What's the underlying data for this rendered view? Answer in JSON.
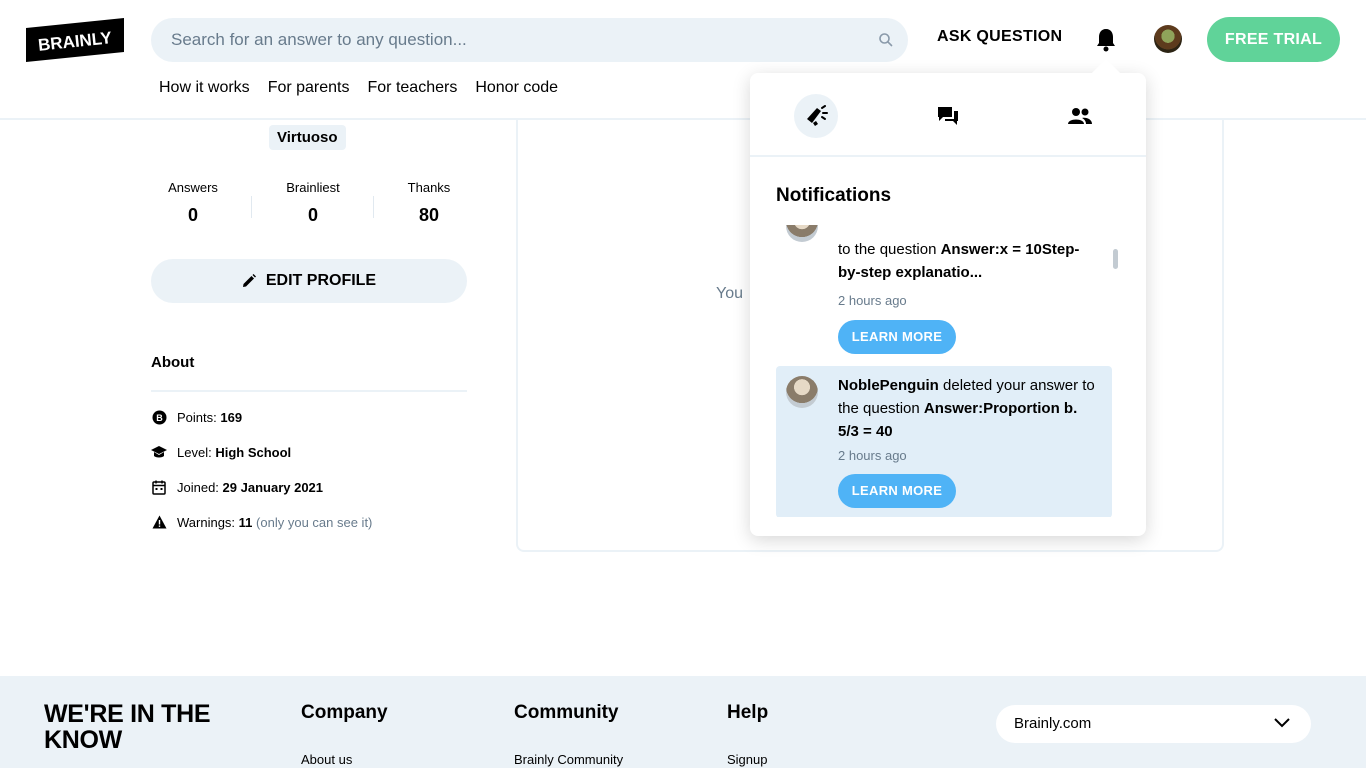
{
  "header": {
    "logo_text": "BRAINLY",
    "search_placeholder": "Search for an answer to any question...",
    "ask_label": "ASK QUESTION",
    "free_trial_label": "FREE TRIAL",
    "nav": [
      "How it works",
      "For parents",
      "For teachers",
      "Honor code"
    ]
  },
  "profile": {
    "rank": "Virtuoso",
    "stats": [
      {
        "label": "Answers",
        "value": "0"
      },
      {
        "label": "Brainliest",
        "value": "0"
      },
      {
        "label": "Thanks",
        "value": "80"
      }
    ],
    "edit_label": "EDIT PROFILE",
    "about_title": "About",
    "points_label": "Points:",
    "points_value": "169",
    "level_label": "Level:",
    "level_value": "High School",
    "joined_label": "Joined:",
    "joined_value": "29 January 2021",
    "warnings_label": "Warnings:",
    "warnings_value": "11",
    "warnings_note": "(only you can see it)"
  },
  "center": {
    "partial_text": "You"
  },
  "notifications": {
    "title": "Notifications",
    "items": [
      {
        "pre": "to the question ",
        "question": "Answer:x = 10Step-by-step explanatio...",
        "time": "2 hours ago",
        "button": "LEARN MORE"
      },
      {
        "user": "NoblePenguin",
        "action": " deleted your answer to the question ",
        "question": "Answer:Proportion b. 5/3 = 40",
        "time": "2 hours ago",
        "button": "LEARN MORE"
      }
    ]
  },
  "footer": {
    "slogan": "WE'RE IN THE KNOW",
    "columns": [
      {
        "heading": "Company",
        "link": "About us"
      },
      {
        "heading": "Community",
        "link": "Brainly Community"
      },
      {
        "heading": "Help",
        "link": "Signup"
      }
    ],
    "market": "Brainly.com"
  },
  "colors": {
    "accent_green": "#60d399",
    "learn_blue": "#4fb3f6",
    "highlight_bg": "#e1eef8",
    "light_gray": "#ebf2f7"
  }
}
